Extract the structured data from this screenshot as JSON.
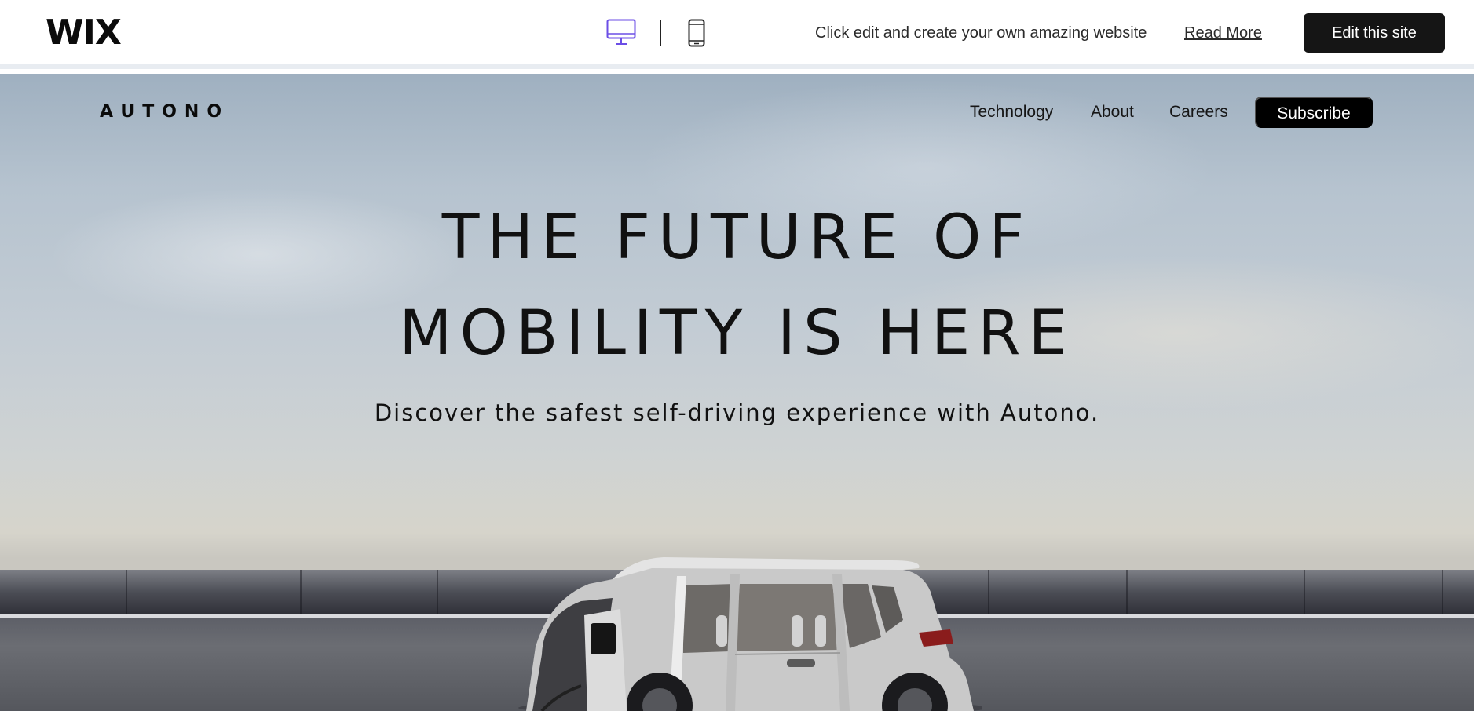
{
  "wix_bar": {
    "logo": "WIX",
    "device_toggle": {
      "desktop_icon": "desktop-monitor-icon",
      "mobile_icon": "mobile-phone-icon",
      "active": "desktop",
      "active_color": "#6b4ee6"
    },
    "tagline": "Click edit and create your own amazing website",
    "read_more_label": "Read More",
    "edit_button_label": "Edit this site"
  },
  "site": {
    "brand": "AUTONO",
    "nav": {
      "items": [
        {
          "label": "Technology"
        },
        {
          "label": "About"
        },
        {
          "label": "Careers"
        }
      ],
      "subscribe_label": "Subscribe"
    },
    "hero": {
      "headline_line1": "THE FUTURE OF",
      "headline_line2": "MOBILITY IS HERE",
      "subheadline": "Discover the safest self-driving experience with Autono.",
      "image": "white-autonomous-car-charging-on-road"
    }
  },
  "colors": {
    "wix_button_bg": "#151515",
    "subscribe_bg": "#000000",
    "text_dark": "#111111",
    "sky_top": "#9fb0c0"
  }
}
